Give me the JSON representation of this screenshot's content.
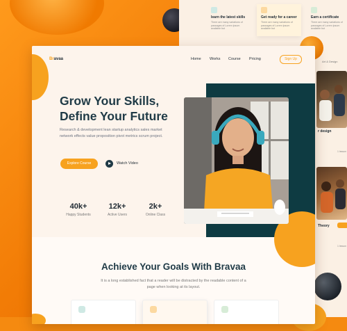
{
  "brand": {
    "name_prefix": "Br",
    "name_suffix": "avaa",
    "accent": "#f7a21f",
    "dark": "#1f3a46",
    "teal": "#0e3b42"
  },
  "nav": {
    "items": [
      "Home",
      "Works",
      "Course",
      "Pricing"
    ],
    "signup": "Sign Up"
  },
  "hero": {
    "title_line1": "Grow Your Skills,",
    "title_line2": "Define Your Future",
    "description": "Research & development lean startup analytics sales market network effects value proposition pivot metrics scrum project.",
    "primary_button": "Explore Course",
    "secondary_button": "Watch Video"
  },
  "stats": [
    {
      "value": "40k+",
      "label": "Happy Students"
    },
    {
      "value": "12k+",
      "label": "Active Users"
    },
    {
      "value": "2k+",
      "label": "Online Class"
    }
  ],
  "goals": {
    "title": "Achieve Your Goals With Bravaa",
    "subtitle": "It is a long established fact that a reader will be distracted by the readable content of a page when looking at its layout."
  },
  "back_page": {
    "features": [
      {
        "title": "learn the latest skills",
        "text": "There are many variations of passages of Lorem Ipsum available but"
      },
      {
        "title": "Get ready for a career",
        "text": "There are many variations of passages of Lorem Ipsum available but"
      },
      {
        "title": "Earn a certificate",
        "text": "There are many variations of passages of Lorem Ipsum available but"
      }
    ],
    "tab": "Art & Design",
    "course1": "r design",
    "course2": "Theory",
    "lessons": "1 lesson"
  }
}
